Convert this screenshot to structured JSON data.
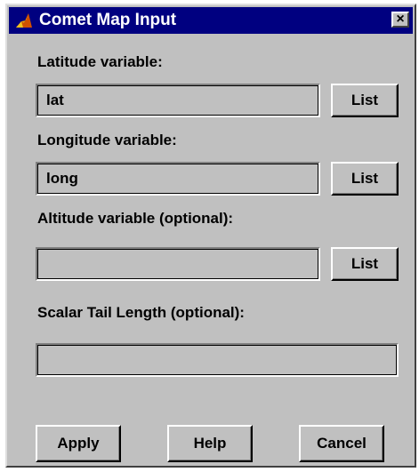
{
  "window": {
    "title": "Comet Map Input",
    "close_glyph": "×",
    "icon": "matlab-logo-icon"
  },
  "fields": {
    "latitude": {
      "label": "Latitude variable:",
      "value": "lat",
      "list_label": "List"
    },
    "longitude": {
      "label": "Longitude variable:",
      "value": "long",
      "list_label": "List"
    },
    "altitude": {
      "label": "Altitude variable (optional):",
      "value": "",
      "list_label": "List"
    },
    "tail_length": {
      "label": "Scalar Tail Length (optional):",
      "value": ""
    }
  },
  "buttons": {
    "apply": "Apply",
    "help": "Help",
    "cancel": "Cancel"
  },
  "colors": {
    "titlebar": "#000080",
    "face": "#c0c0c0"
  }
}
